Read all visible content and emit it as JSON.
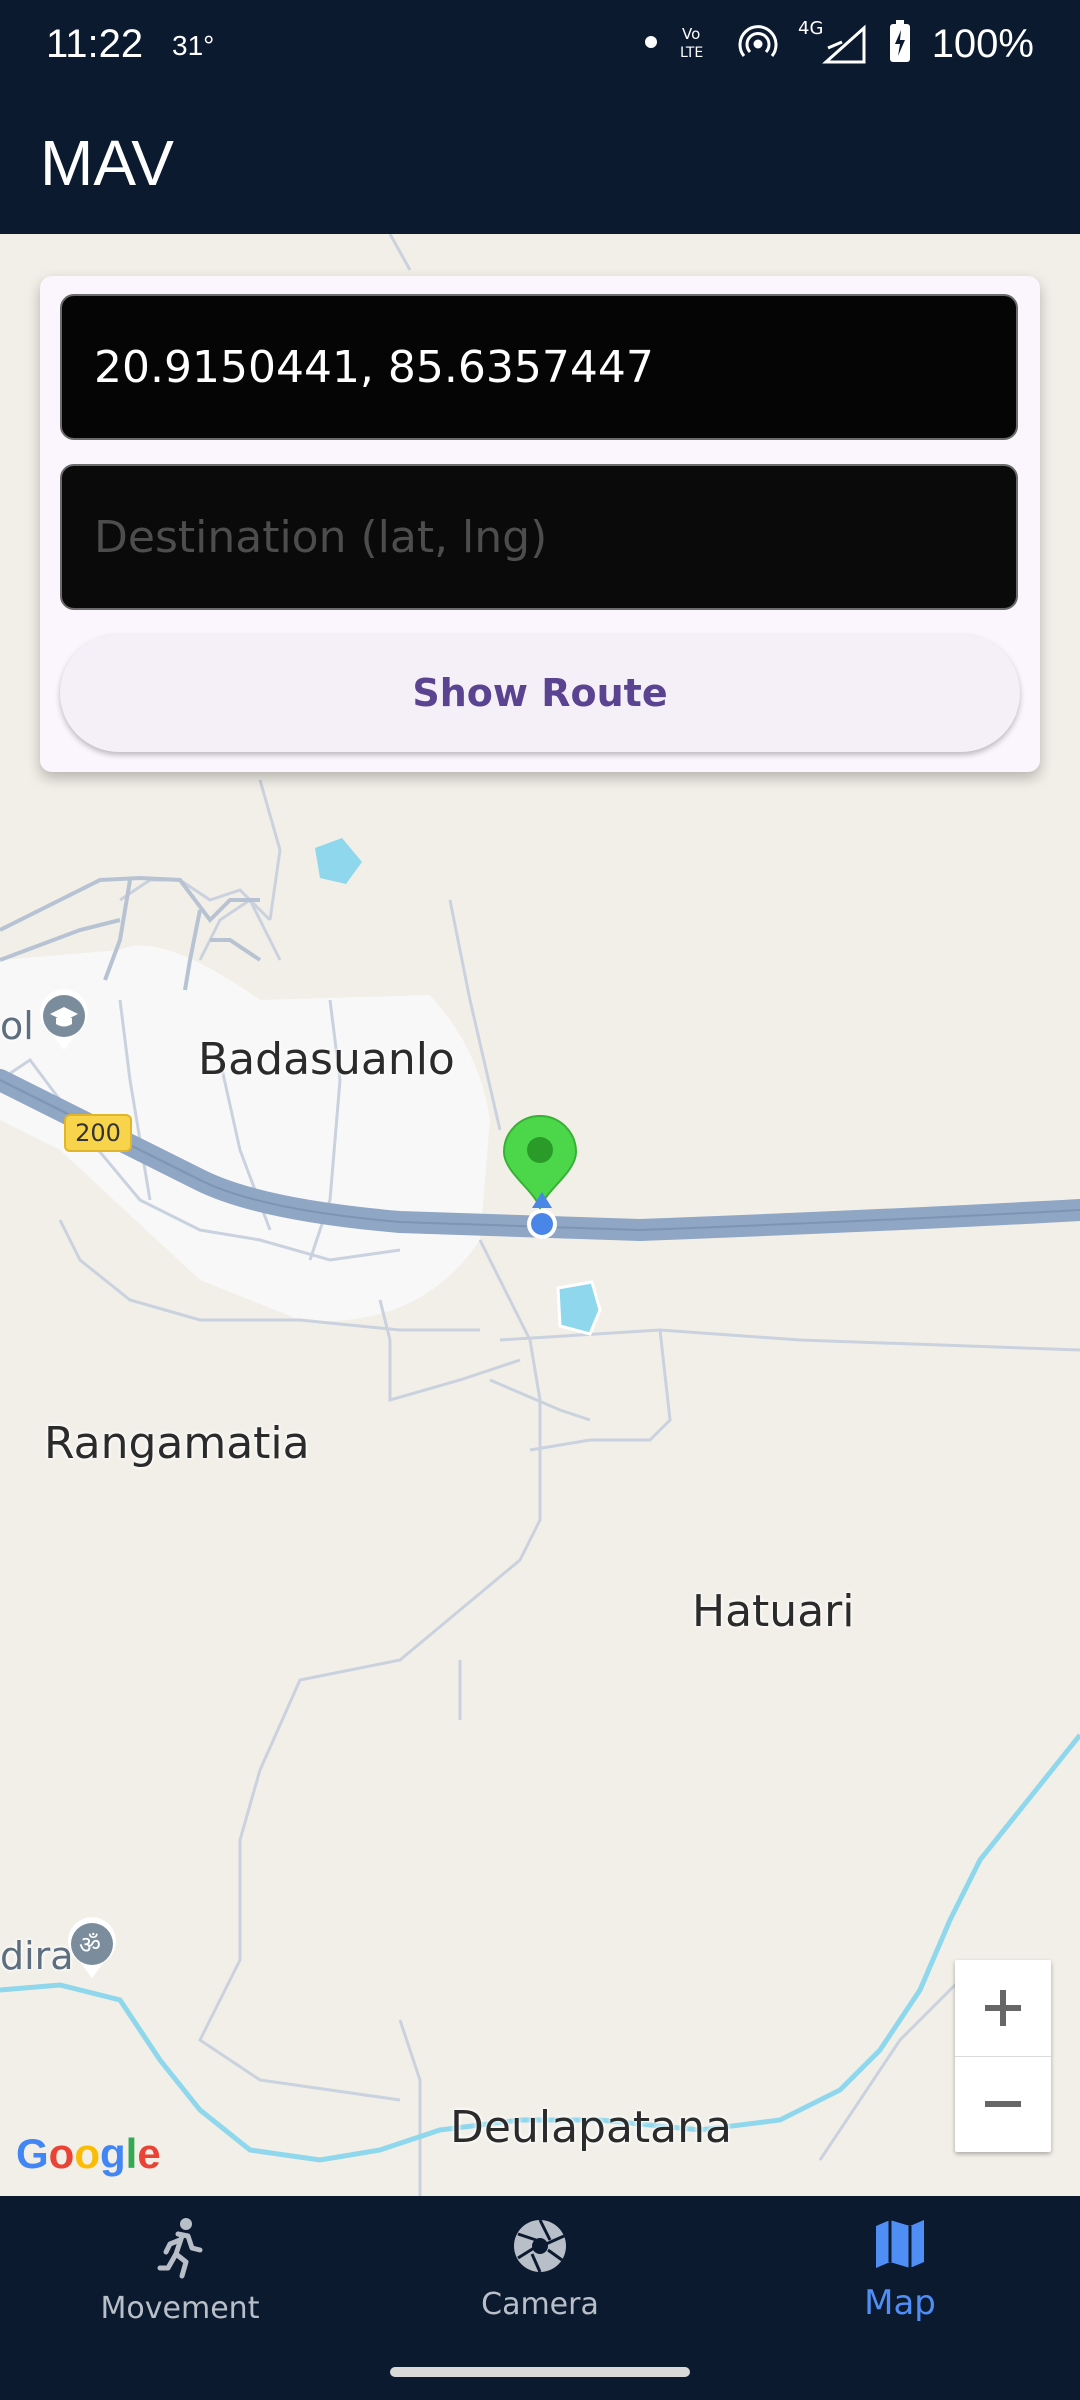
{
  "status_bar": {
    "time": "11:22",
    "temperature": "31°",
    "battery": "100%",
    "network": "4G",
    "icons": [
      "dot-icon",
      "volte-icon",
      "hotspot-icon",
      "signal-icon",
      "battery-icon"
    ]
  },
  "app_bar": {
    "title": "MAV"
  },
  "route_form": {
    "origin_value": "20.9150441, 85.6357447",
    "destination_placeholder": "Destination (lat, lng)",
    "show_route_label": "Show Route"
  },
  "map": {
    "labels": {
      "badasuanlo": "Badasuanlo",
      "rangamatia": "Rangamatia",
      "hatuari": "Hatuari",
      "deulapatana": "Deulapatana",
      "partial_left_top": "ol",
      "partial_left_bottom": "dira",
      "road_shield": "200"
    },
    "attribution": "Google",
    "zoom_in_label": "+",
    "zoom_out_label": "−",
    "colors": {
      "land": "#f2efe8",
      "highway": "#8fa6c4",
      "water": "#8fd7ec",
      "marker": "#4cd64a",
      "location_dot": "#4a86e8"
    }
  },
  "bottom_nav": {
    "items": [
      {
        "label": "Movement",
        "icon": "running-person-icon",
        "active": false
      },
      {
        "label": "Camera",
        "icon": "camera-shutter-icon",
        "active": false
      },
      {
        "label": "Map",
        "icon": "map-icon",
        "active": true
      }
    ]
  },
  "colors": {
    "app_bar": "#0c1a30",
    "accent": "#4f8ef5",
    "button_text": "#5a4390"
  }
}
